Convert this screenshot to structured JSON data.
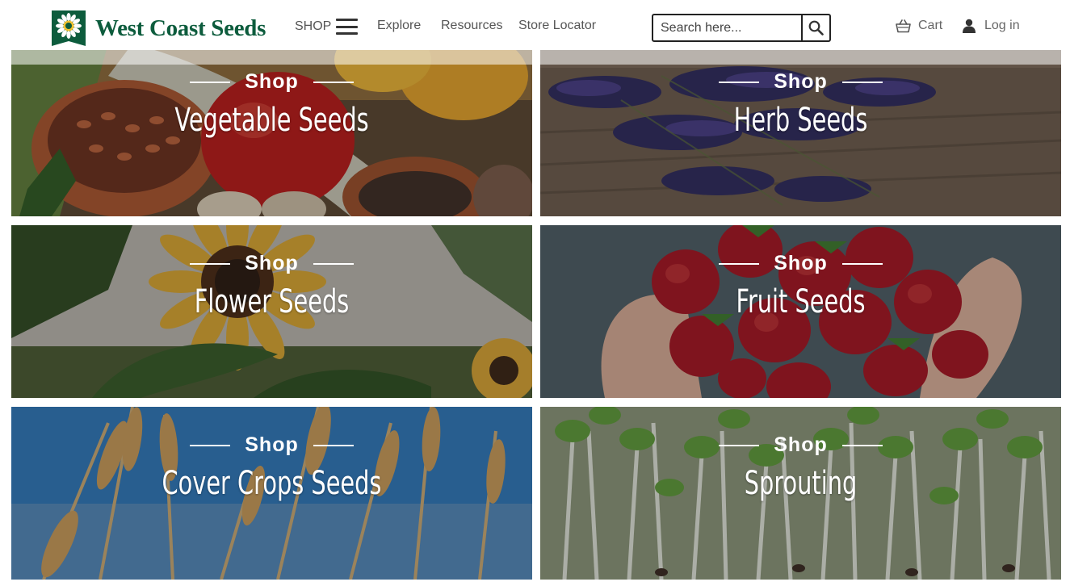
{
  "header": {
    "brand": "West Coast Seeds",
    "nav": {
      "shop": "SHOP",
      "explore": "Explore",
      "resources": "Resources",
      "store_locator": "Store Locator"
    },
    "search": {
      "placeholder": "Search here..."
    },
    "cart": "Cart",
    "login": "Log in"
  },
  "tiles": [
    {
      "kicker": "Shop",
      "title": "Vegetable Seeds"
    },
    {
      "kicker": "Shop",
      "title": "Herb Seeds"
    },
    {
      "kicker": "Shop",
      "title": "Flower Seeds"
    },
    {
      "kicker": "Shop",
      "title": "Fruit Seeds"
    },
    {
      "kicker": "Shop",
      "title": "Cover Crops Seeds"
    },
    {
      "kicker": "Shop",
      "title": "Sprouting"
    }
  ],
  "colors": {
    "brand_green": "#0d5c3d",
    "nav_text": "#555555"
  }
}
